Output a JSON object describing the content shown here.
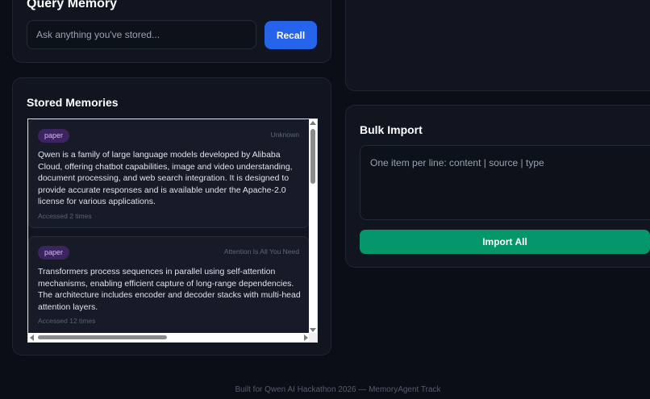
{
  "query": {
    "title": "Query Memory",
    "placeholder": "Ask anything you've stored...",
    "value": "",
    "button_label": "Recall"
  },
  "memories": {
    "title": "Stored Memories",
    "items": [
      {
        "tag": "paper",
        "source": "Unknown",
        "content": "Qwen is a family of large language models developed by Alibaba Cloud, offering chatbot capabilities, image and video understanding, document processing, and web search integration. It is designed to provide accurate responses and is available under the Apache-2.0 license for various applications.",
        "accessed": "Accessed 2 times"
      },
      {
        "tag": "paper",
        "source": "Attention Is All You Need",
        "content": "Transformers process sequences in parallel using self-attention mechanisms, enabling efficient capture of long-range dependencies. The architecture includes encoder and decoder stacks with multi-head attention layers.",
        "accessed": "Accessed 12 times"
      }
    ]
  },
  "bulk_import": {
    "title": "Bulk Import",
    "placeholder": "One item per line: content | source | type",
    "button_label": "Import All"
  },
  "footer": {
    "text": "Built for Qwen AI Hackathon 2026 — MemoryAgent Track"
  },
  "colors": {
    "background": "#0b0e17",
    "recall_button": "#2563eb",
    "import_button": "#059669",
    "tag_bg": "#3b2460"
  }
}
